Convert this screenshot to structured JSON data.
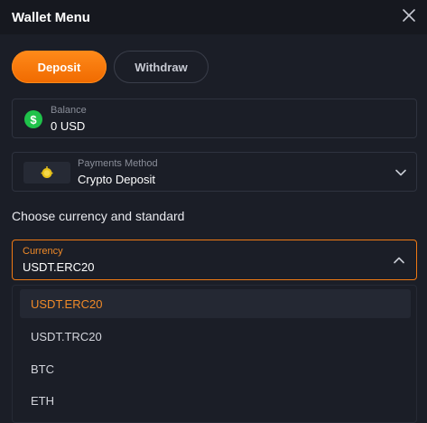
{
  "header": {
    "title": "Wallet Menu"
  },
  "tabs": [
    {
      "label": "Deposit",
      "active": true
    },
    {
      "label": "Withdraw",
      "active": false
    }
  ],
  "balance": {
    "label": "Balance",
    "value": "0 USD"
  },
  "payment": {
    "label": "Payments Method",
    "value": "Crypto Deposit"
  },
  "section": {
    "heading": "Choose currency and standard"
  },
  "currency": {
    "label": "Currency",
    "value": "USDT.ERC20",
    "options": [
      {
        "label": "USDT.ERC20",
        "selected": true
      },
      {
        "label": "USDT.TRC20",
        "selected": false
      },
      {
        "label": "BTC",
        "selected": false
      },
      {
        "label": "ETH",
        "selected": false
      }
    ]
  },
  "colors": {
    "accent": "#f07a14",
    "background": "#1b1e27",
    "success": "#1fc24a"
  },
  "icons": [
    "close-icon",
    "dollar-icon",
    "crypto-coin-icon",
    "chevron-down-icon",
    "chevron-up-icon"
  ]
}
